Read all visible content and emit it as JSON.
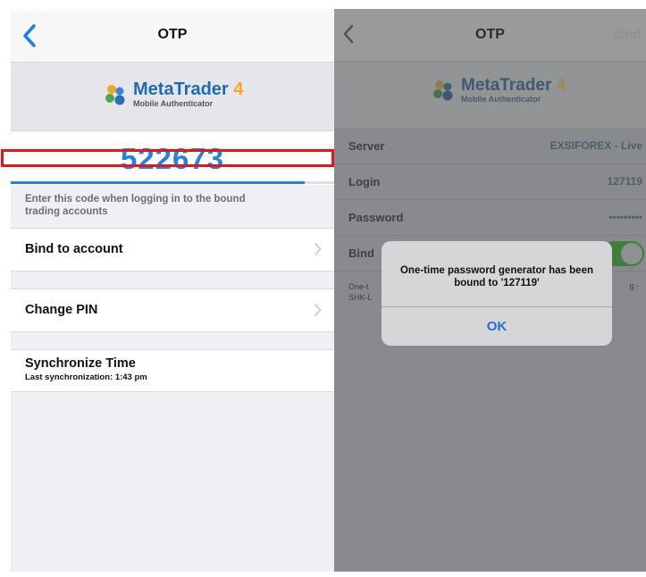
{
  "left": {
    "nav_title": "OTP",
    "logo_name": "MetaTrader",
    "logo_version": "4",
    "logo_subtitle": "Mobile Authenticator",
    "otp_code": "522673",
    "progress_fraction": 0.91,
    "hint_text": "Enter this code when logging in to the bound trading accounts",
    "bind_label": "Bind to account",
    "change_pin_label": "Change PIN",
    "sync_label": "Synchronize Time",
    "sync_sublabel": "Last synchronization: 1:43 pm"
  },
  "right": {
    "nav_title": "OTP",
    "nav_right": "Bind",
    "logo_name": "MetaTrader",
    "logo_version": "4",
    "logo_subtitle": "Mobile Authenticator",
    "server_label": "Server",
    "server_value": "EXSIFOREX - Live",
    "login_label": "Login",
    "login_value": "127119",
    "password_label": "Password",
    "password_value": "•••••••••",
    "bind_label": "Bind",
    "desc_left": "One-t",
    "desc_left2": "SHK-L",
    "desc_right": "g -",
    "dialog_message": "One-time password generator has been bound to '127119'",
    "dialog_ok": "OK"
  },
  "colors": {
    "accent": "#1e82e8",
    "highlight": "#e8141b"
  }
}
